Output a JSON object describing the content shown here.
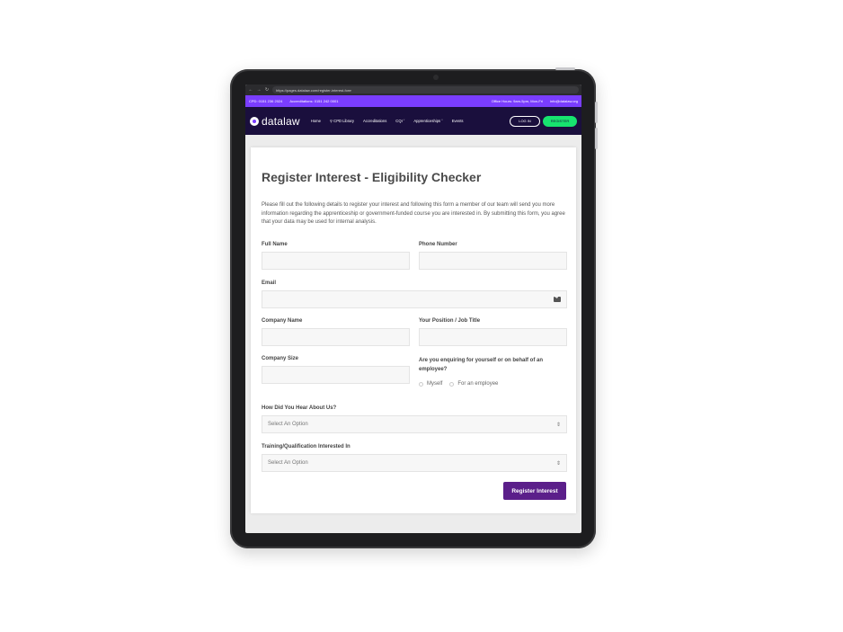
{
  "browser": {
    "url": "https://pages.datalaw.com/register-interest-form"
  },
  "topbar": {
    "phone": "CPD: 0151 236 2024",
    "accreditations": "Accreditations: 0151 242 0001",
    "hours": "Office Hours: 9am-5pm, Mon-Fri",
    "email": "info@datalaw.org"
  },
  "nav": {
    "logo": "datalaw",
    "items": [
      "Home",
      "CPD Library",
      "Accreditations",
      "CQI",
      "Apprenticeships",
      "Events"
    ],
    "login": "LOG IN",
    "register": "REGISTER"
  },
  "form": {
    "title": "Register Interest - Eligibility Checker",
    "intro": "Please fill out the following details to register your interest and following this form a member of our team will send you more information regarding the apprenticeship or government-funded course you are interested in. By submitting this form, you agree that your data may be used for internal analysis.",
    "full_name_label": "Full Name",
    "phone_label": "Phone Number",
    "email_label": "Email",
    "company_name_label": "Company Name",
    "position_label": "Your Position / Job Title",
    "company_size_label": "Company Size",
    "enquiring_label": "Are you enquiring for yourself or on behalf of an employee?",
    "radio_myself": "Myself",
    "radio_employee": "For an employee",
    "hear_label": "How Did You Hear About Us?",
    "hear_placeholder": "Select An Option",
    "training_label": "Training/Qualification Interested In",
    "training_placeholder": "Select An Option",
    "submit": "Register Interest"
  },
  "colors": {
    "topbar": "#7a3dff",
    "navbar": "#1a0f3d",
    "register_button": "#17e36f",
    "submit_button": "#5b1f8a"
  }
}
